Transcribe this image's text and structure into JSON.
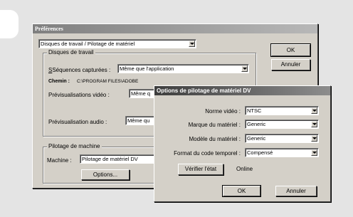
{
  "prefs": {
    "title": "Préférences",
    "section_select": "Disques de travail / Pilotage de matériel",
    "ok": "OK",
    "cancel": "Annuler",
    "scratch_group": "Disques de travail",
    "captured_label": "Séquences capturées :",
    "captured_value": "Même que l'application",
    "path_label": "Chemin :",
    "path_value": "C:\\PROGRAM FILES\\ADOBE",
    "video_preview_label": "Prévisualisations vidéo :",
    "video_preview_value": "Même q",
    "audio_preview_label": "Prévisualisation audio :",
    "audio_preview_value": "Même qu",
    "device_group": "Pilotage de machine",
    "machine_label": "Machine :",
    "machine_value": "Pilotage de matériel DV",
    "options_button": "Options..."
  },
  "dv": {
    "title": "Options de pilotage de matériel DV",
    "norm_label": "Norme vidéo :",
    "norm_value": "NTSC",
    "brand_label": "Marque du matériel :",
    "brand_value": "Generic",
    "model_label": "Modèle du matériel :",
    "model_value": "Generic",
    "timecode_label": "Format du code temporel :",
    "timecode_value": "Compensé",
    "check_button": "Vérifier l'état",
    "status_value": "Online",
    "ok": "OK",
    "cancel": "Annuler"
  }
}
